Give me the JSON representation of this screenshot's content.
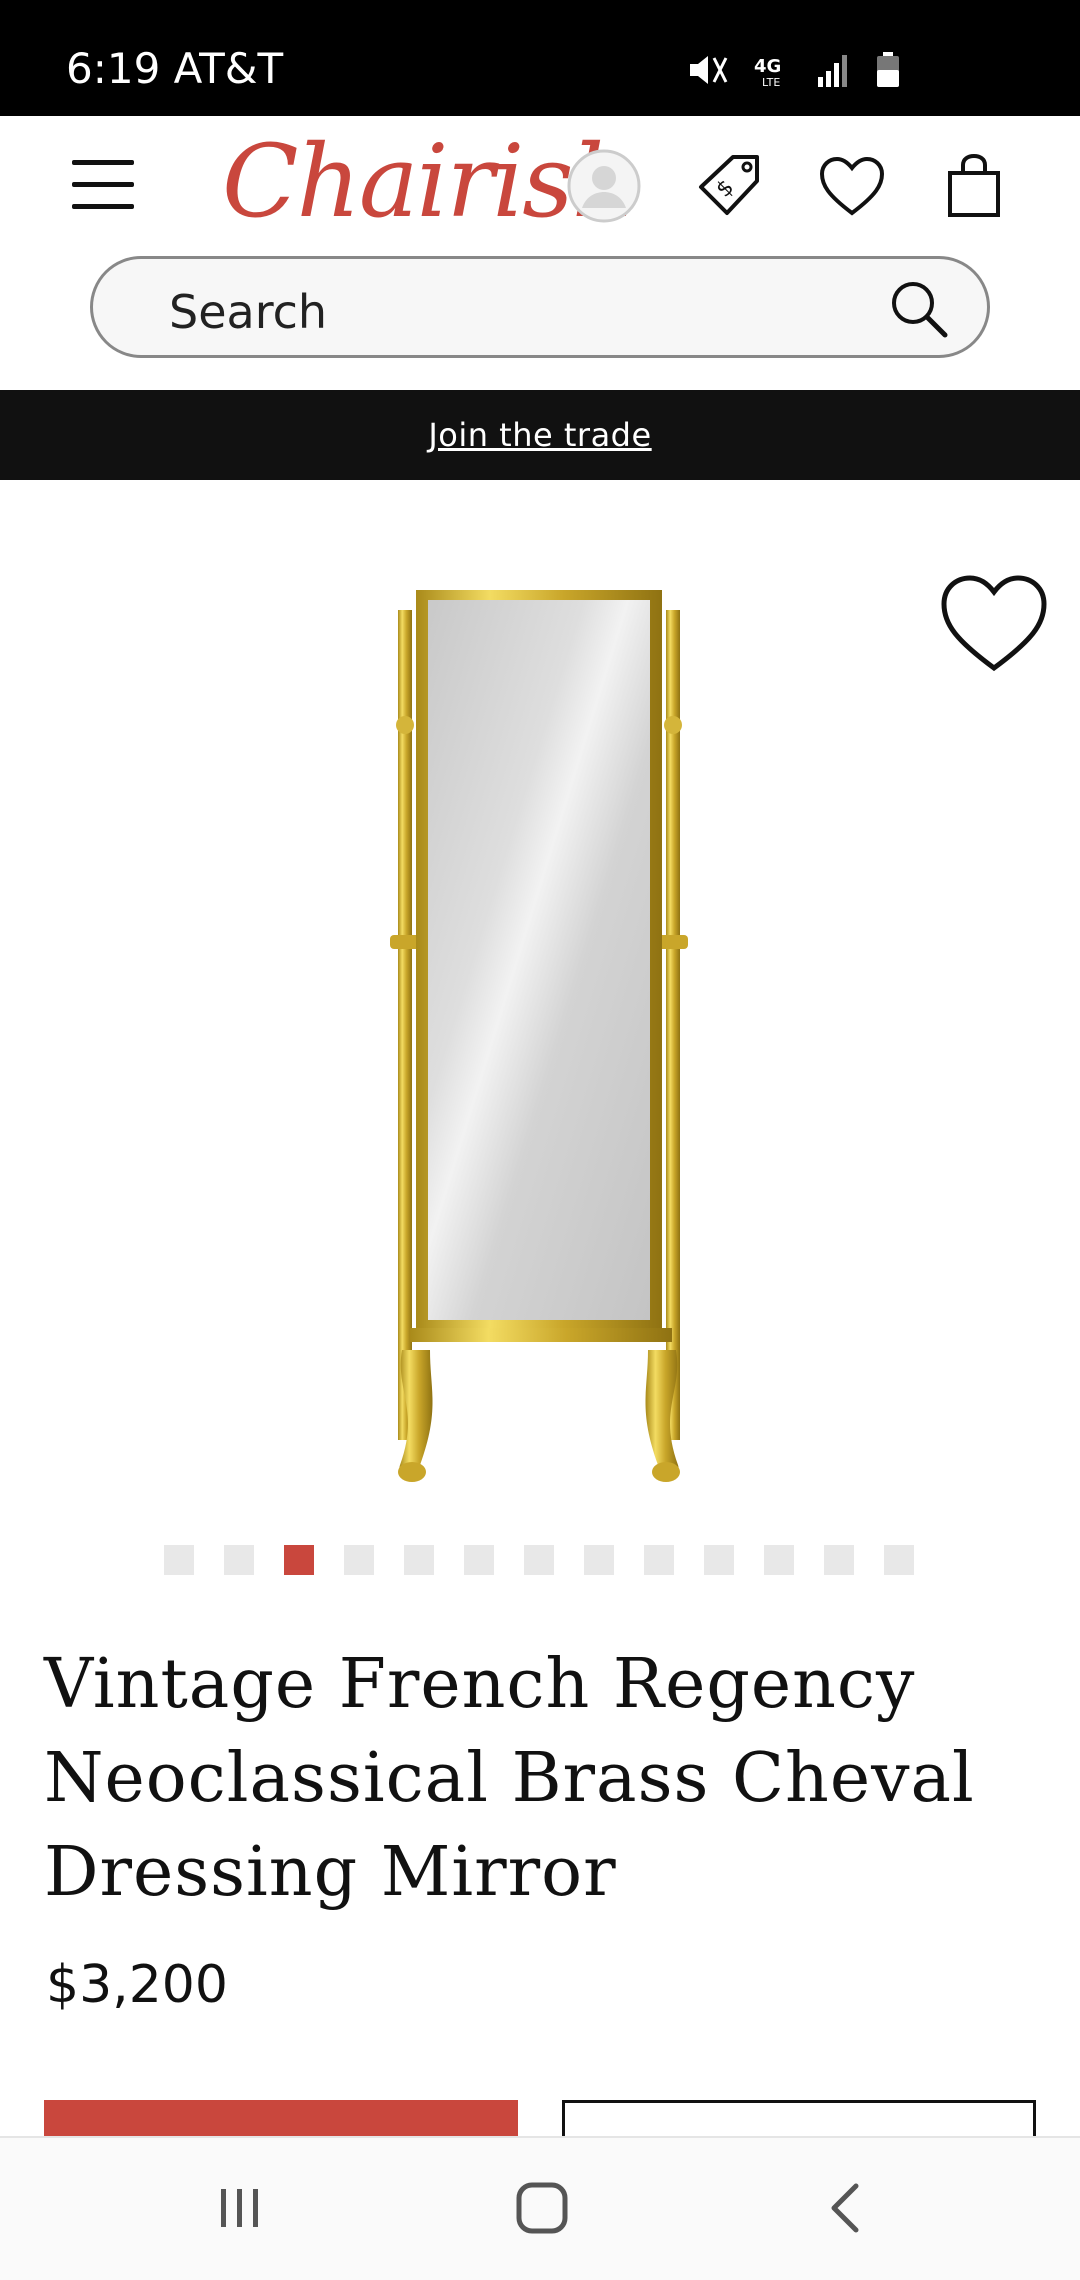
{
  "status_bar": {
    "time_carrier": "6:19 AT&T",
    "network": "4G LTE"
  },
  "header": {
    "logo_text": "Chairish",
    "search_placeholder": "Search"
  },
  "trade_banner": {
    "link_label": "Join the trade"
  },
  "product": {
    "image_description_icon": "brass-cheval-mirror",
    "carousel": {
      "total": 13,
      "active_index": 2
    },
    "title": "Vintage French Regency Neoclassical Brass Cheval Dressing Mirror",
    "price": "$3,200"
  },
  "colors": {
    "brand": "#c9473d",
    "banner_bg": "#111111",
    "dot_inactive": "#e8e8e8",
    "dot_active": "#c9473d"
  }
}
